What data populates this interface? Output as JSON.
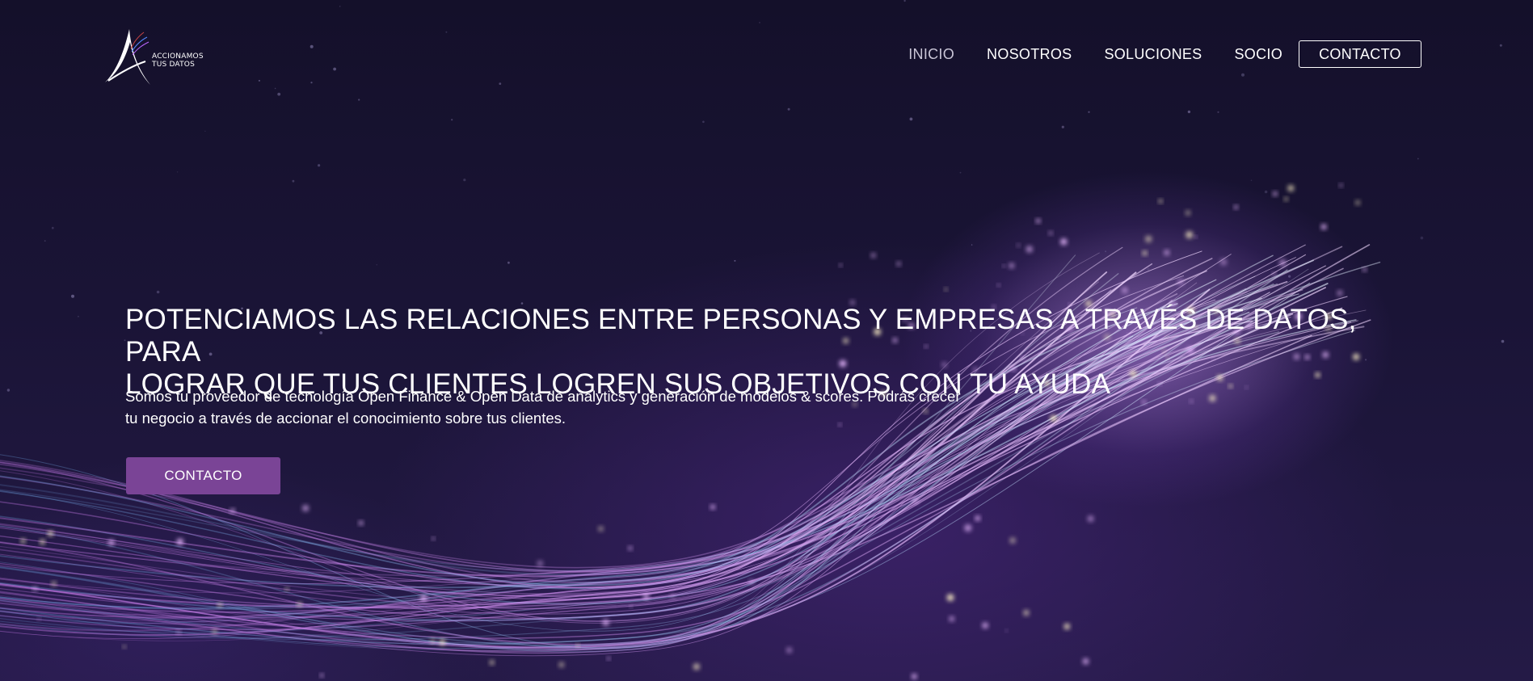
{
  "brand": {
    "logo_line1": "ACCIONAMOS",
    "logo_line2": "TUS DATOS"
  },
  "nav": {
    "items": [
      {
        "label": "INICIO",
        "active": true
      },
      {
        "label": "NOSOTROS",
        "active": false
      },
      {
        "label": "SOLUCIONES",
        "active": false
      },
      {
        "label": "SOCIO",
        "active": false
      }
    ],
    "contact_label": "CONTACTO"
  },
  "hero": {
    "headline_line1": "POTENCIAMOS LAS RELACIONES ENTRE PERSONAS Y EMPRESAS A TRAVÉS DE DATOS, PARA",
    "headline_line2": "LOGRAR QUE TUS CLIENTES LOGREN SUS OBJETIVOS CON TU AYUDA",
    "subtext_line1": "Somos tu proveedor de tecnología Open Finance & Open Data de analytics y generación de modelos & scores. Podrás crecer",
    "subtext_line2": "tu negocio a través de accionar el conocimiento sobre tus clientes.",
    "cta_label": "CONTACTO"
  },
  "colors": {
    "background": "#130f29",
    "accent": "#7a4496",
    "text": "#ffffff",
    "nav_active": "#c9c5d6"
  },
  "icons": {
    "logo": "accionamos-a-logo",
    "background": "fiber-optic-light-streams"
  }
}
